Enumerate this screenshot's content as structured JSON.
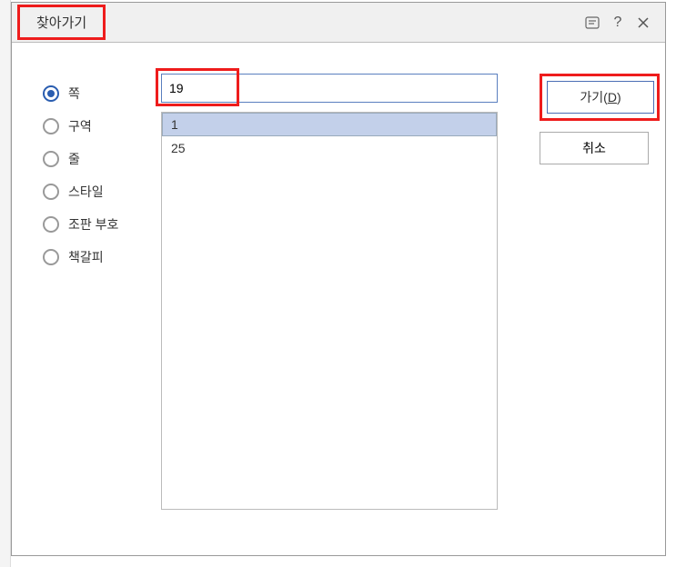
{
  "dialog": {
    "title": "찾아가기",
    "radios": [
      {
        "label": "쪽",
        "selected": true
      },
      {
        "label": "구역",
        "selected": false
      },
      {
        "label": "줄",
        "selected": false
      },
      {
        "label": "스타일",
        "selected": false
      },
      {
        "label": "조판 부호",
        "selected": false
      },
      {
        "label": "책갈피",
        "selected": false
      }
    ],
    "input_value": "19",
    "list_items": [
      {
        "label": "1",
        "selected": true
      },
      {
        "label": "25",
        "selected": false
      }
    ],
    "buttons": {
      "go_prefix": "가기(",
      "go_key": "D",
      "go_suffix": ")",
      "cancel": "취소"
    }
  }
}
